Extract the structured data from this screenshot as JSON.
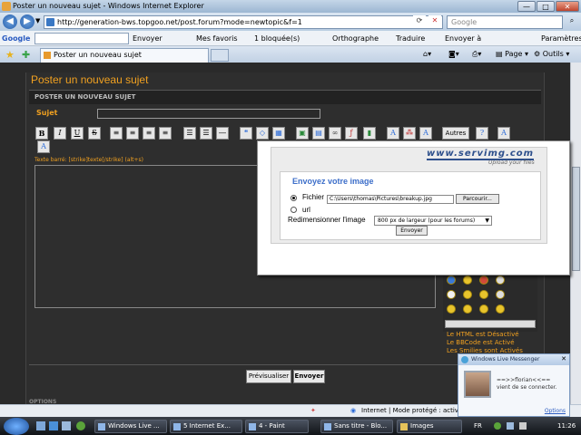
{
  "window": {
    "title": "Poster un nouveau sujet - Windows Internet Explorer"
  },
  "address": {
    "url": "http://generation-bws.topgoo.net/post.forum?mode=newtopic&f=1",
    "search_placeholder": "Google"
  },
  "google_toolbar": {
    "logo": "Google",
    "send": "Envoyer",
    "favorites": "Mes favoris",
    "blocked": "1 bloquée(s)",
    "spelling": "Orthographe",
    "translate": "Traduire",
    "send_to": "Envoyer à",
    "settings": "Paramètres"
  },
  "tabbar": {
    "tab_title": "Poster un nouveau sujet",
    "page_menu": "Page",
    "tools_menu": "Outils"
  },
  "forum": {
    "page_title": "Poster un nouveau sujet",
    "panel_title": "POSTER UN NOUVEAU SUJET",
    "subject_label": "Sujet",
    "toolbar": {
      "bold": "B",
      "italic": "I",
      "underline": "U",
      "strike": "S",
      "others": "Autres"
    },
    "hint": "Texte barré: [strike]texte[/strike] (alt+s)",
    "bbinfo": [
      "Le HTML est Désactivé",
      "Le BBCode est Activé",
      "Les Smilies sont Activés"
    ],
    "preview_button": "Prévisualiser",
    "send_button": "Envoyer",
    "options_label": "OPTIONS"
  },
  "upload": {
    "brand": "www.servimg.com",
    "brand_sub": "Upload your files",
    "title": "Envoyez votre image",
    "file_label": "Fichier",
    "file_path": "C:\\Users\\thomas\\Pictures\\breakup.jpg",
    "browse_button": "Parcourir...",
    "url_label": "url",
    "resize_label": "Redimensionner l'image",
    "resize_value": "800 px de largeur (pour les forums)",
    "send_button": "Envoyer"
  },
  "statusbar": {
    "zone": "Internet | Mode protégé : activé"
  },
  "taskbar": {
    "items": [
      "Windows Live ...",
      "5 Internet Ex...",
      "4 - Paint",
      "Sans titre - Blo...",
      "Images"
    ],
    "language": "FR",
    "clock": "11:26"
  },
  "messenger": {
    "header": "Windows Live Messenger",
    "message_line1": "==>>florian<<==",
    "message_line2": "vient de se connecter.",
    "options": "Options"
  }
}
